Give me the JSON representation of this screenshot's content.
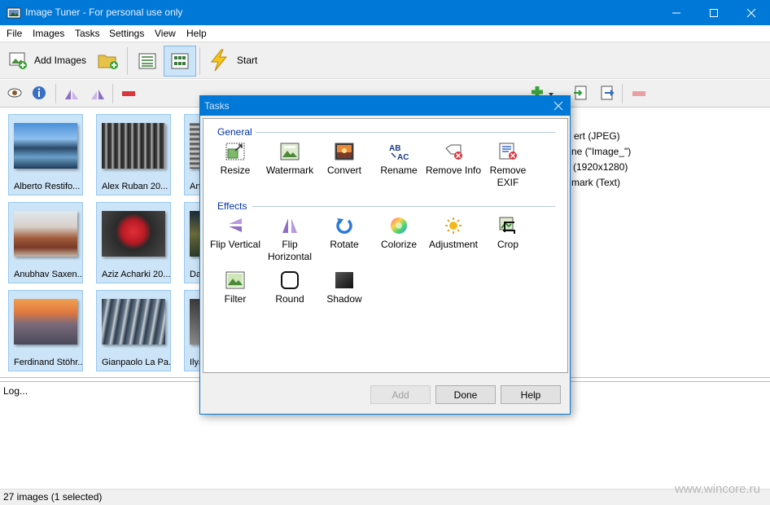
{
  "window": {
    "title": "Image Tuner - For personal use only"
  },
  "menu": [
    "File",
    "Images",
    "Tasks",
    "Settings",
    "View",
    "Help"
  ],
  "toolbar": {
    "add_images": "Add Images",
    "start": "Start"
  },
  "gallery": {
    "thumbs": [
      {
        "label": "Alberto Restifo..."
      },
      {
        "label": "Alex Ruban  20..."
      },
      {
        "label": "An"
      },
      {
        "label": "Anubhav Saxen..."
      },
      {
        "label": "Aziz Acharki  20..."
      },
      {
        "label": "Da"
      },
      {
        "label": "Ferdinand Stöhr..."
      },
      {
        "label": "Gianpaolo La Pa..."
      },
      {
        "label": "Ilya"
      }
    ]
  },
  "task_list": [
    "ert (JPEG)",
    "ne (\"Image_\")",
    "(1920x1280)",
    "mark (Text)"
  ],
  "log": {
    "text": "Log..."
  },
  "status": {
    "text": "27 images (1 selected)"
  },
  "watermark": "www.wincore.ru",
  "dialog": {
    "title": "Tasks",
    "general_header": "General",
    "effects_header": "Effects",
    "general": [
      {
        "label": "Resize",
        "icon": "resize-icon"
      },
      {
        "label": "Watermark",
        "icon": "watermark-icon"
      },
      {
        "label": "Convert",
        "icon": "convert-icon"
      },
      {
        "label": "Rename",
        "icon": "rename-icon"
      },
      {
        "label": "Remove Info",
        "icon": "remove-info-icon"
      },
      {
        "label": "Remove EXIF",
        "icon": "remove-exif-icon"
      }
    ],
    "effects": [
      {
        "label": "Flip Vertical",
        "icon": "flip-vertical-icon"
      },
      {
        "label": "Flip Horizontal",
        "icon": "flip-horizontal-icon"
      },
      {
        "label": "Rotate",
        "icon": "rotate-icon"
      },
      {
        "label": "Colorize",
        "icon": "colorize-icon"
      },
      {
        "label": "Adjustment",
        "icon": "adjustment-icon"
      },
      {
        "label": "Crop",
        "icon": "crop-icon"
      },
      {
        "label": "Filter",
        "icon": "filter-icon"
      },
      {
        "label": "Round",
        "icon": "round-icon"
      },
      {
        "label": "Shadow",
        "icon": "shadow-icon"
      }
    ],
    "buttons": {
      "add": "Add",
      "done": "Done",
      "help": "Help"
    }
  },
  "colors": {
    "accent": "#0078d7",
    "selection": "#cce4f7",
    "group_header": "#0033a0"
  }
}
